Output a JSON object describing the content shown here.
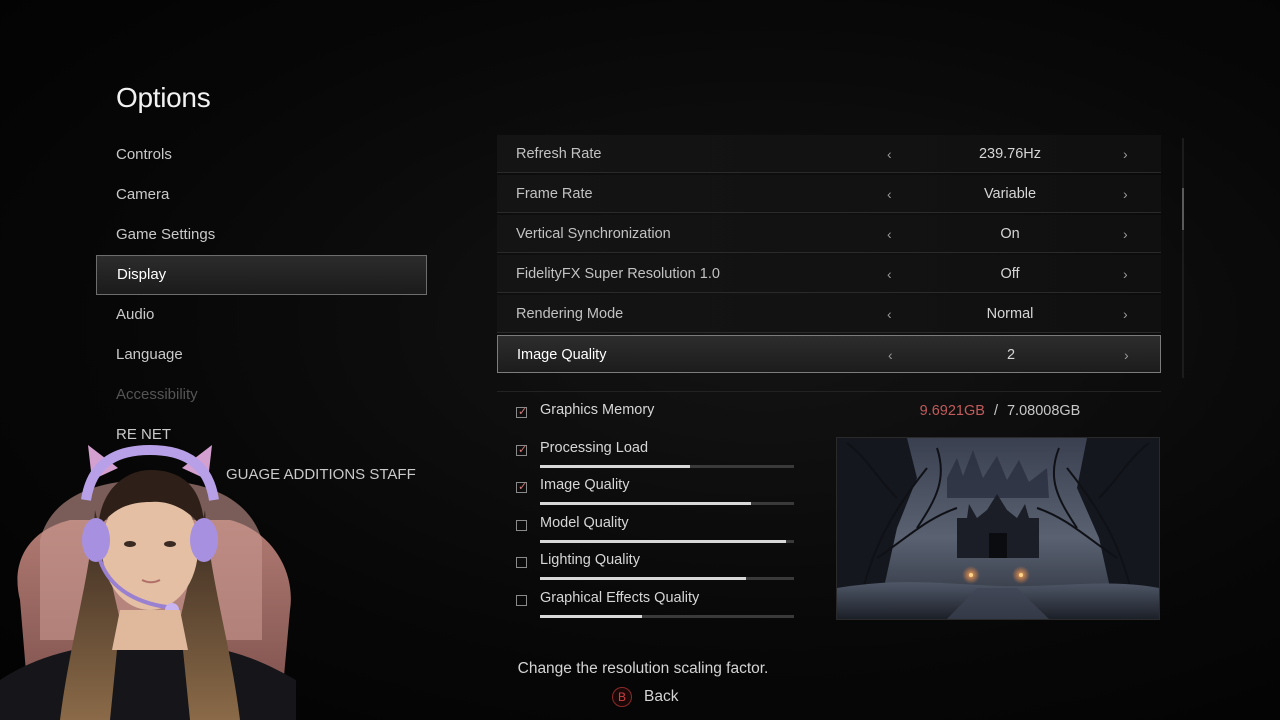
{
  "title": "Options",
  "nav": {
    "items": [
      {
        "label": "Controls"
      },
      {
        "label": "Camera"
      },
      {
        "label": "Game Settings"
      },
      {
        "label": "Display"
      },
      {
        "label": "Audio"
      },
      {
        "label": "Language"
      },
      {
        "label": "Accessibility"
      },
      {
        "label": "RE NET"
      }
    ],
    "active": "Display",
    "partial_item": "GUAGE ADDITIONS STAFF"
  },
  "settings": [
    {
      "label": "Refresh Rate",
      "value": "239.76Hz"
    },
    {
      "label": "Frame Rate",
      "value": "Variable"
    },
    {
      "label": "Vertical Synchronization",
      "value": "On"
    },
    {
      "label": "FidelityFX Super Resolution 1.0",
      "value": "Off"
    },
    {
      "label": "Rendering Mode",
      "value": "Normal"
    },
    {
      "label": "Image Quality",
      "value": "2"
    }
  ],
  "selected_setting": "Image Quality",
  "memory": {
    "used": "9.6921GB",
    "separator": "/",
    "total": "7.08008GB",
    "used_color": "#c25b5b"
  },
  "load_items": [
    {
      "label": "Graphics Memory",
      "checked": true,
      "level": null
    },
    {
      "label": "Processing Load",
      "checked": true,
      "level": 0.59
    },
    {
      "label": "Image Quality",
      "checked": true,
      "level": 0.83
    },
    {
      "label": "Model Quality",
      "checked": false,
      "level": 0.97
    },
    {
      "label": "Lighting Quality",
      "checked": false,
      "level": 0.81
    },
    {
      "label": "Graphical Effects Quality",
      "checked": false,
      "level": 0.4
    }
  ],
  "help_text": "Change the resolution scaling factor.",
  "back": {
    "button": "B",
    "label": "Back"
  },
  "colors": {
    "accent_red": "#c25b5b",
    "background": "#050505"
  }
}
